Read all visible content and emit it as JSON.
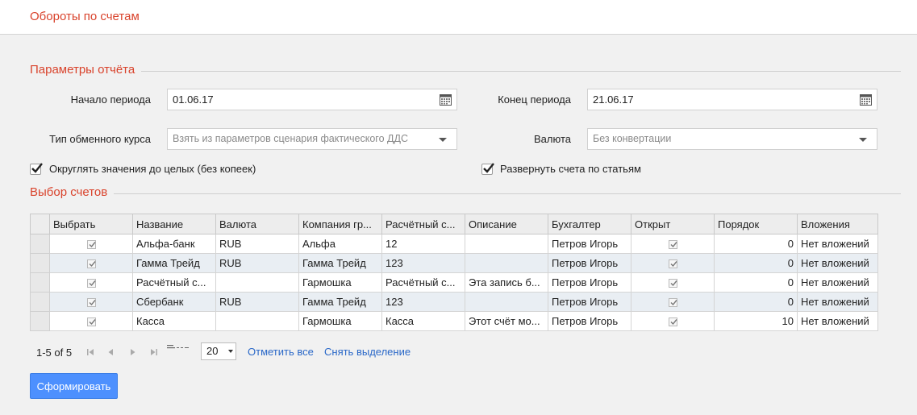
{
  "page": {
    "title": "Обороты по счетам"
  },
  "params": {
    "section_title": "Параметры отчёта",
    "start_label": "Начало периода",
    "start_value": "01.06.17",
    "end_label": "Конец периода",
    "end_value": "21.06.17",
    "rate_label": "Тип обменного курса",
    "rate_placeholder": "Взять из параметров сценария фактического ДДС",
    "currency_label": "Валюта",
    "currency_placeholder": "Без конвертации",
    "round_label": "Округлять значения до целых (без копеек)",
    "round_checked": true,
    "expand_label": "Развернуть счета по статьям",
    "expand_checked": true
  },
  "accounts": {
    "section_title": "Выбор счетов",
    "columns": [
      "Выбрать",
      "Название",
      "Валюта",
      "Компания гр...",
      "Расчётный с...",
      "Описание",
      "Бухгалтер",
      "Открыт",
      "Порядок",
      "Вложения"
    ],
    "rows": [
      {
        "selected": true,
        "name": "Альфа-банк",
        "currency": "RUB",
        "company": "Альфа",
        "account": "12",
        "description": "",
        "accountant": "Петров Игорь",
        "open": true,
        "order": "0",
        "attachments": "Нет вложений"
      },
      {
        "selected": true,
        "name": "Гамма Трейд",
        "currency": "RUB",
        "company": "Гамма Трейд",
        "account": "123",
        "description": "",
        "accountant": "Петров Игорь",
        "open": true,
        "order": "0",
        "attachments": "Нет вложений"
      },
      {
        "selected": true,
        "name": "Расчётный с...",
        "currency": "",
        "company": "Гармошка",
        "account": "Расчётный с...",
        "description": "Эта запись б...",
        "accountant": "Петров Игорь",
        "open": true,
        "order": "0",
        "attachments": "Нет вложений"
      },
      {
        "selected": true,
        "name": "Сбербанк",
        "currency": "RUB",
        "company": "Гамма Трейд",
        "account": "123",
        "description": "",
        "accountant": "Петров Игорь",
        "open": true,
        "order": "0",
        "attachments": "Нет вложений"
      },
      {
        "selected": true,
        "name": "Касса",
        "currency": "",
        "company": "Гармошка",
        "account": "Касса",
        "description": "Этот счёт мо...",
        "accountant": "Петров Игорь",
        "open": true,
        "order": "10",
        "attachments": "Нет вложений"
      }
    ]
  },
  "pager": {
    "count_text": "1-5 of 5",
    "page_size": "20",
    "select_all": "Отметить все",
    "deselect": "Снять выделение"
  },
  "actions": {
    "submit_label": "Сформировать"
  },
  "colors": {
    "accent": "#d9432c",
    "link": "#2a68c8",
    "button": "#4d90fe",
    "alt_row": "#e9eef3"
  }
}
